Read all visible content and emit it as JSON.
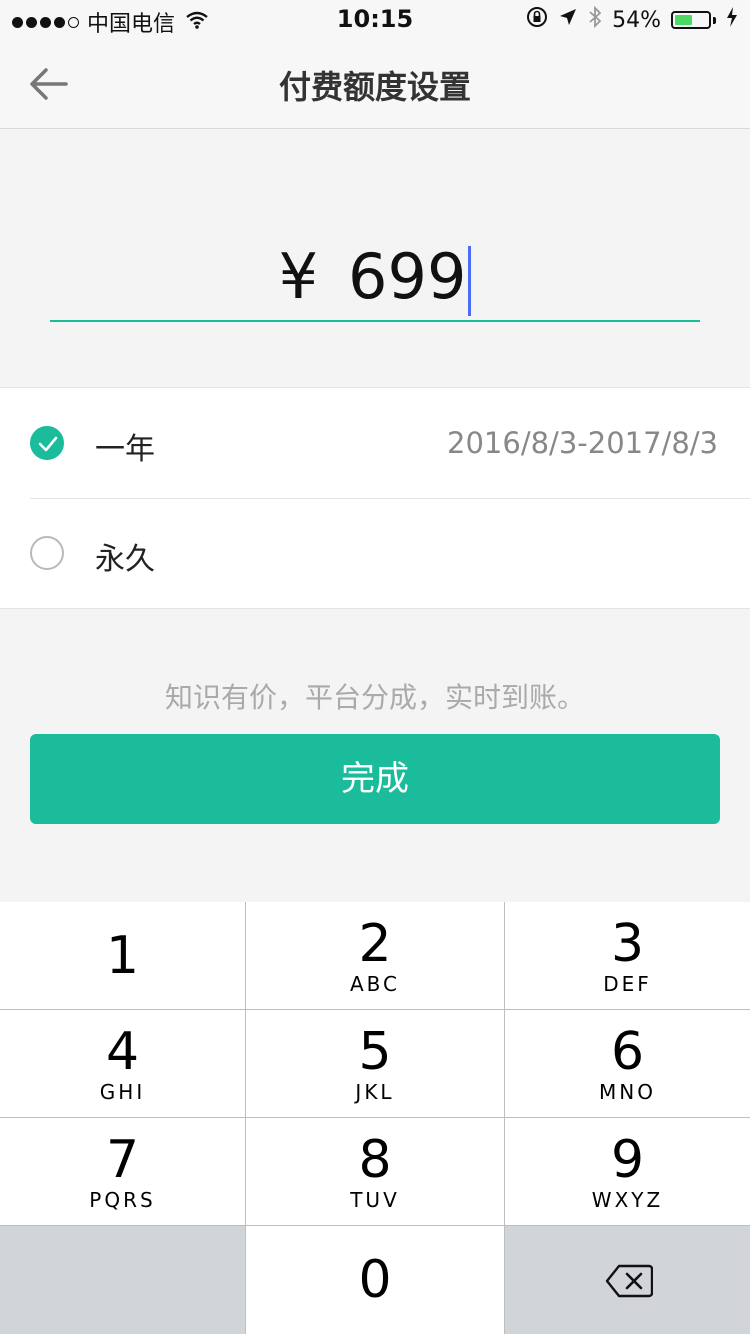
{
  "status_bar": {
    "carrier": "中国电信",
    "time": "10:15",
    "battery_percent": "54%",
    "battery_level": 0.54
  },
  "nav": {
    "title": "付费额度设置"
  },
  "amount": {
    "currency": "¥",
    "value": "699"
  },
  "options": [
    {
      "label": "一年",
      "date_range": "2016/8/3-2017/8/3",
      "checked": true
    },
    {
      "label": "永久",
      "date_range": "",
      "checked": false
    }
  ],
  "hint": "知识有价，平台分成，实时到账。",
  "done_label": "完成",
  "keypad": [
    {
      "num": "1",
      "letters": ""
    },
    {
      "num": "2",
      "letters": "ABC"
    },
    {
      "num": "3",
      "letters": "DEF"
    },
    {
      "num": "4",
      "letters": "GHI"
    },
    {
      "num": "5",
      "letters": "JKL"
    },
    {
      "num": "6",
      "letters": "MNO"
    },
    {
      "num": "7",
      "letters": "PQRS"
    },
    {
      "num": "8",
      "letters": "TUV"
    },
    {
      "num": "9",
      "letters": "WXYZ"
    },
    {
      "num": "0",
      "letters": ""
    }
  ],
  "colors": {
    "accent": "#1abc9c",
    "caret": "#4a6cf7",
    "battery": "#4cd964"
  }
}
